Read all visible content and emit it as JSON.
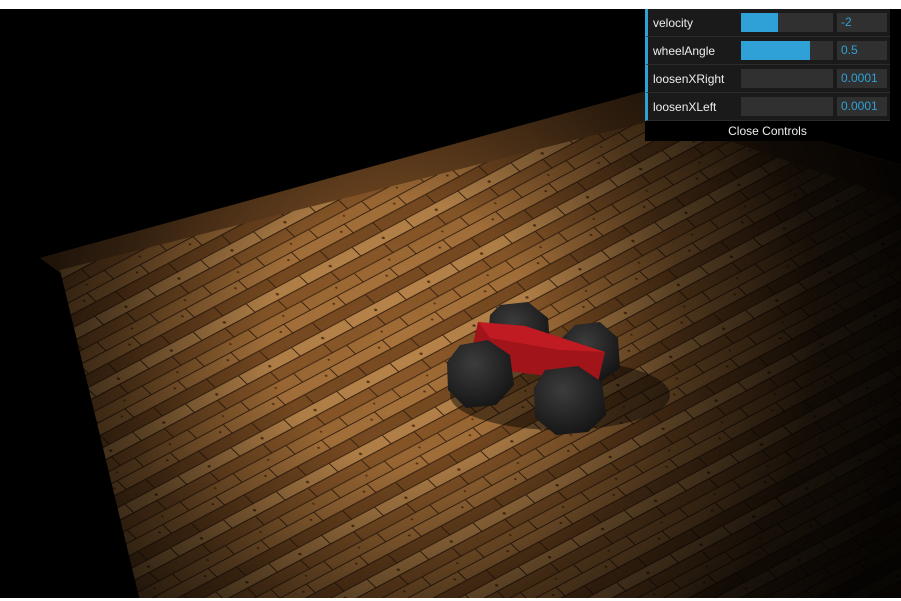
{
  "controls": [
    {
      "name": "velocity",
      "label": "velocity",
      "value": "-2",
      "fill": 0.4
    },
    {
      "name": "wheel-angle",
      "label": "wheelAngle",
      "value": "0.5",
      "fill": 0.75
    },
    {
      "name": "loosen-x-right",
      "label": "loosenXRight",
      "value": "0.0001",
      "fill": 0.0
    },
    {
      "name": "loosen-x-left",
      "label": "loosenXLeft",
      "value": "0.0001",
      "fill": 0.0
    }
  ],
  "close_label": "Close Controls",
  "colors": {
    "accent": "#2fa1d6",
    "panel_bg": "#1a1a1a",
    "car_body": "#a1141a",
    "wheel": "#2a2a2a",
    "floor": "#8a5a2b"
  }
}
